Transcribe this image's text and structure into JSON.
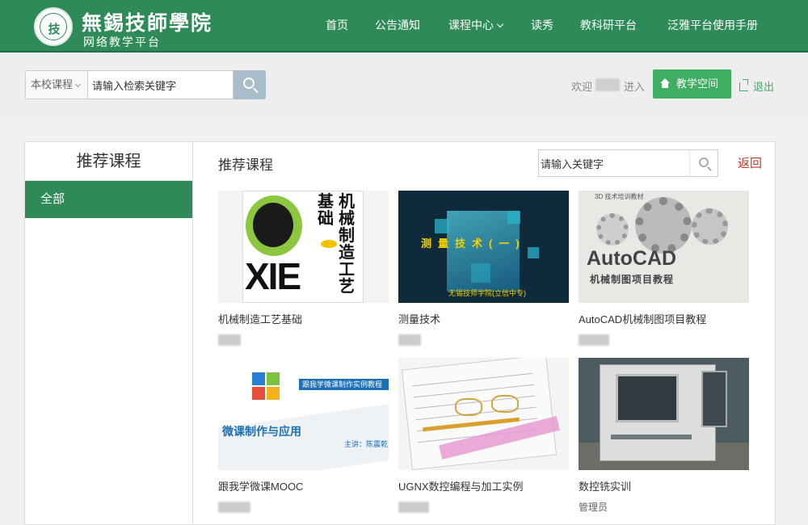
{
  "header": {
    "logo_title": "無錫技師學院",
    "logo_subtitle": "网络教学平台",
    "seal_glyph": "技",
    "nav": [
      "首页",
      "公告通知",
      "课程中心",
      "读秀",
      "教科研平台",
      "泛雅平台使用手册"
    ]
  },
  "search": {
    "scope_label": "本校课程",
    "placeholder": "请输入检索关键字",
    "value": "请输入检索关键字"
  },
  "user": {
    "welcome": "欢迎",
    "enter": "进入",
    "space_button": "教学空间",
    "logout": "退出"
  },
  "sidebar": {
    "title": "推荐课程",
    "items": [
      {
        "label": "全部",
        "active": true
      }
    ]
  },
  "main": {
    "title": "推荐课程",
    "search_value": "请输入关键字",
    "back": "返回",
    "courses": [
      {
        "title": "机械制造工艺基础",
        "teacher": ""
      },
      {
        "title": "测量技术",
        "teacher": ""
      },
      {
        "title": "AutoCAD机械制图项目教程",
        "teacher": ""
      },
      {
        "title": "跟我学微课MOOC",
        "teacher": ""
      },
      {
        "title": "UGNX数控编程与加工实例",
        "teacher": ""
      },
      {
        "title": "数控铣实训",
        "teacher": "管理员"
      }
    ],
    "covers": {
      "c1_word": "XIE",
      "c1_title_a": "机械制造工艺",
      "c1_title_b": "基础",
      "c2_head": "测量技术(一)",
      "c2_foot": "无锡技师学院(立信中专)",
      "c3_tag": "3D 技术培训教材",
      "c3_big": "AutoCAD",
      "c3_sub": "机械制图项目教程",
      "c4_banner": "跟我学微课制作实例教程",
      "c4_title": "微课制作与应用",
      "c4_lecturer": "主讲：陈震乾"
    }
  },
  "colors": {
    "brand_green": "#2e8b57",
    "button_green": "#3fae62",
    "back_red": "#c0392b"
  }
}
